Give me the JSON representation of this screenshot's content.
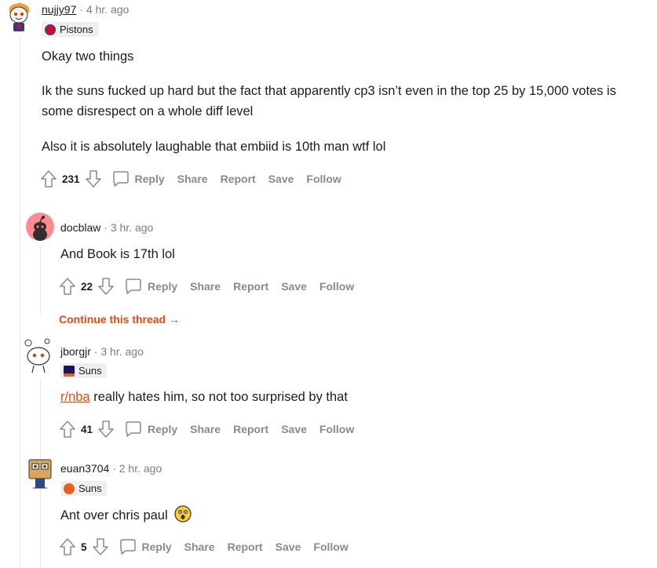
{
  "comments": [
    {
      "username": "nujjy97",
      "time": "4 hr. ago",
      "flair": "Pistons",
      "paragraphs": [
        "Okay two things",
        "Ik the suns fucked up hard but the fact that apparently cp3 isn’t even in the top 25 by 15,000 votes is some disrespect on a whole diff level",
        "Also it is absolutely laughable that embiid is 10th man wtf lol"
      ],
      "votes": "231"
    },
    {
      "username": "docblaw",
      "time": "3 hr. ago",
      "paragraphs": [
        "And Book is 17th lol"
      ],
      "votes": "22",
      "continue_label": "Continue this thread",
      "continue_arrow": "→"
    },
    {
      "username": "jborgjr",
      "time": "3 hr. ago",
      "flair": "Suns",
      "link_text": "r/nba",
      "text_after_link": " really hates him, so not too surprised by that",
      "votes": "41"
    },
    {
      "username": "euan3704",
      "time": "2 hr. ago",
      "flair": "Suns",
      "paragraphs": [
        "Ant over chris paul"
      ],
      "votes": "5"
    }
  ],
  "actions": {
    "reply": "Reply",
    "share": "Share",
    "report": "Report",
    "save": "Save",
    "follow": "Follow"
  },
  "separator": "·",
  "colors": {
    "accent": "#e8480c",
    "muted": "#878a8c",
    "text": "#1c1c1c",
    "thread": "#e6e6e6"
  }
}
